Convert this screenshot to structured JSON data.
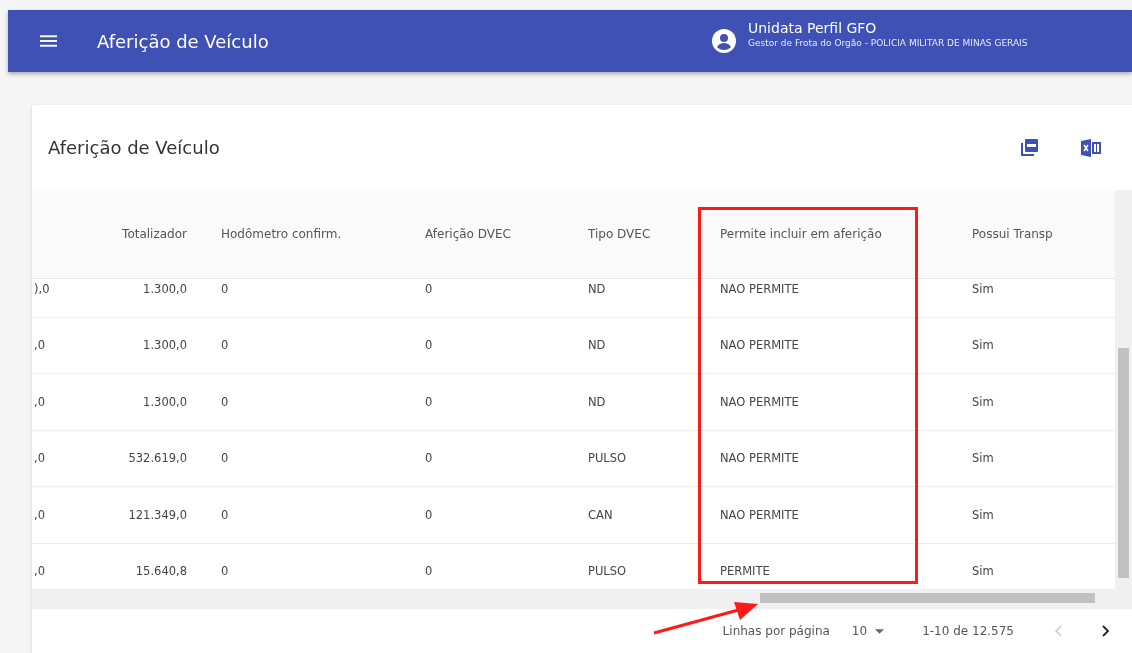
{
  "app_bar": {
    "title": "Aferição de Veículo",
    "user_name": "Unidata Perfil GFO",
    "user_role": "Gestor de Frota do Orgão - POLICIA MILITAR DE MINAS GERAIS"
  },
  "card": {
    "title": "Aferição de Veículo"
  },
  "table": {
    "columns": [
      null,
      "Totalizador",
      "Hodômetro confirm.",
      "Aferição DVEC",
      "Tipo DVEC",
      "Permite incluir em aferição",
      "Possui Transp"
    ],
    "rows": [
      [
        "),0",
        "1.300,0",
        "0",
        "0",
        "ND",
        "NAO PERMITE",
        "Sim"
      ],
      [
        ",0",
        "1.300,0",
        "0",
        "0",
        "ND",
        "NAO PERMITE",
        "Sim"
      ],
      [
        ",0",
        "1.300,0",
        "0",
        "0",
        "ND",
        "NAO PERMITE",
        "Sim"
      ],
      [
        ",0",
        "532.619,0",
        "0",
        "0",
        "PULSO",
        "NAO PERMITE",
        "Sim"
      ],
      [
        ",0",
        "121.349,0",
        "0",
        "0",
        "CAN",
        "NAO PERMITE",
        "Sim"
      ],
      [
        ",0",
        "15.640,8",
        "0",
        "0",
        "PULSO",
        "PERMITE",
        "Sim"
      ]
    ]
  },
  "pagination": {
    "rows_per_page_label": "Linhas por página",
    "rows_per_page": "10",
    "range": "1-10 de 12.575",
    "prev_disabled": true,
    "next_disabled": false
  }
}
